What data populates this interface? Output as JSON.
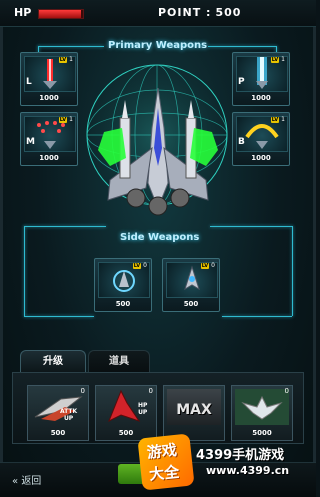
{
  "hud": {
    "hp_label": "HP",
    "hp_fraction": 0.95,
    "point_label": "POINT :",
    "point_value": "500"
  },
  "primary": {
    "title": "Primary Weapons",
    "slots": [
      {
        "key": "L",
        "lv_prefix": "LV",
        "level": "1",
        "price": "1000",
        "icon": "red-laser-icon"
      },
      {
        "key": "M",
        "lv_prefix": "LV",
        "level": "1",
        "price": "1000",
        "icon": "missile-spread-icon"
      },
      {
        "key": "P",
        "lv_prefix": "LV",
        "level": "1",
        "price": "1000",
        "icon": "plasma-beam-icon"
      },
      {
        "key": "B",
        "lv_prefix": "LV",
        "level": "1",
        "price": "1000",
        "icon": "boomerang-arc-icon"
      }
    ]
  },
  "side": {
    "title": "Side Weapons",
    "slots": [
      {
        "lv_prefix": "LV",
        "level": "0",
        "price": "500",
        "icon": "side-drone-icon"
      },
      {
        "lv_prefix": "LV",
        "level": "0",
        "price": "500",
        "icon": "side-turret-icon"
      }
    ]
  },
  "tabs": {
    "upgrade": "升级",
    "items": "道具"
  },
  "shop": {
    "items": [
      {
        "count": "0",
        "tag": "ATTK\nUP",
        "cost": "500",
        "icon": "attack-up-icon"
      },
      {
        "count": "0",
        "tag": "HP\nUP",
        "cost": "500",
        "icon": "hp-up-icon"
      },
      {
        "count": "",
        "tag": "MAX",
        "cost": "",
        "icon": "max-icon"
      },
      {
        "count": "0",
        "tag": "",
        "cost": "5000",
        "icon": "wings-emblem-icon"
      }
    ]
  },
  "footer": {
    "back_label": "返回",
    "back_icon": "double-chevron-left-icon"
  },
  "watermark": {
    "logo_top": "游戏",
    "logo_bottom": "大全",
    "line1": "4399手机游戏",
    "line2": "www.4399.cn"
  },
  "colors": {
    "accent": "#2fbad0",
    "green_ring": "#27ff3a",
    "level_badge": "#e8c400"
  }
}
